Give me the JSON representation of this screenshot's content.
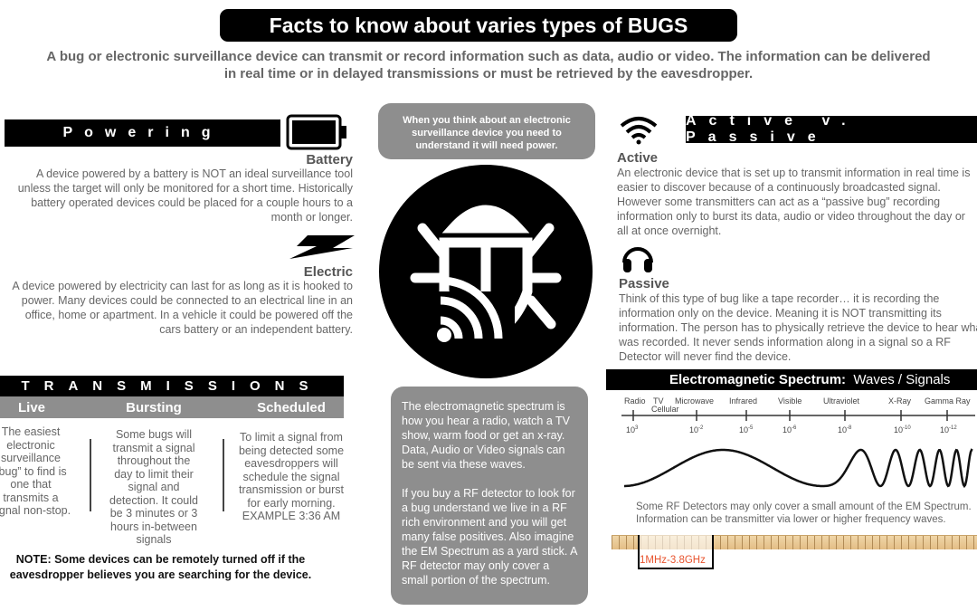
{
  "title": "Facts to know about varies types of BUGS",
  "subtitle": [
    "A bug or electronic surveillance device can transmit or record information such as data, audio or video.  The information can be delivered",
    "in real time or in delayed transmissions or must be retrieved by the eavesdropper."
  ],
  "powering": {
    "heading": "Powering",
    "battery": {
      "icon": "battery-icon",
      "label": "Battery",
      "text": "A device powered by a battery is NOT an ideal surveillance tool unless the target will only be monitored for a short time.  Historically battery operated devices could be placed for a couple hours to a month or longer."
    },
    "electric": {
      "icon": "lightning-icon",
      "label": "Electric",
      "text": "A device powered by electricity can last for as long as it is hooked to power.  Many devices could be connected to an electrical line in an office, home or apartment.  In a vehicle it could be powered off the cars battery or an independent battery."
    }
  },
  "center_top": "When you think about an electronic surveillance device you need to understand it will need power.",
  "center_icon": "bug-signal-icon",
  "center_bottom": [
    "The electromagnetic spectrum is how you hear a radio, watch a TV show, warm food or get an x-ray. Data, Audio or Video signals can be sent via these waves.",
    "If you buy a RF detector to look for a bug understand we live in a RF rich environment and you will get many false positives.  Also imagine the EM Spectrum as a yard stick.   A RF detector may only cover a small portion of the spectrum."
  ],
  "active_passive": {
    "heading": "Active v. Passive",
    "active": {
      "icon": "wifi-icon",
      "label": "Active",
      "text": "An electronic device that is set up to transmit information in real time is easier to discover because of a continuously broadcasted signal. However some transmitters can act as a “passive bug” recording information only to burst its data, audio or video throughout the day or all at once overnight."
    },
    "passive": {
      "icon": "headphones-icon",
      "label": "Passive",
      "text": "Think of this type of bug like a tape recorder… it is recording the information only on the device. Meaning it is NOT transmitting its information.  The person has to physically retrieve the device to hear what was recorded.   It never sends information along in a signal so a RF Detector will never find the device."
    }
  },
  "transmissions": {
    "heading": "TRANSMISSIONS",
    "columns": [
      {
        "label": "Live",
        "text": "The easiest electronic surveillance “bug” to find is one that transmits a signal non-stop."
      },
      {
        "label": "Bursting",
        "text": "Some bugs will transmit a signal throughout the day to limit their signal and detection. It could be 3 minutes or 3 hours in-between signals"
      },
      {
        "label": "Scheduled",
        "text": "To limit a signal from being detected some eavesdroppers will schedule the signal transmission or burst for early morning. EXAMPLE 3:36 AM"
      }
    ],
    "note": "NOTE:  Some devices can be remotely turned off if the eavesdropper believes you are searching for the device."
  },
  "em": {
    "heading_bold": "Electromagnetic Spectrum:",
    "heading_rest": "Waves / Signals",
    "bands": [
      "Radio",
      "TV",
      "Cellular",
      "Microwave",
      "Infrared",
      "Visible",
      "Ultraviolet",
      "X-Ray",
      "Gamma Ray"
    ],
    "ticks": [
      [
        "10",
        "3"
      ],
      [
        "10",
        "-2"
      ],
      [
        "10",
        "-5"
      ],
      [
        "10",
        "-6"
      ],
      [
        "10",
        "-8"
      ],
      [
        "10",
        "-10"
      ],
      [
        "10",
        "-12"
      ]
    ],
    "caption": "Some RF Detectors may only cover a small amount of the EM Spectrum. Information can be transmitter via lower or higher frequency waves.",
    "range_label": "1MHz-3.8GHz",
    "range_color": "#e8542f"
  }
}
